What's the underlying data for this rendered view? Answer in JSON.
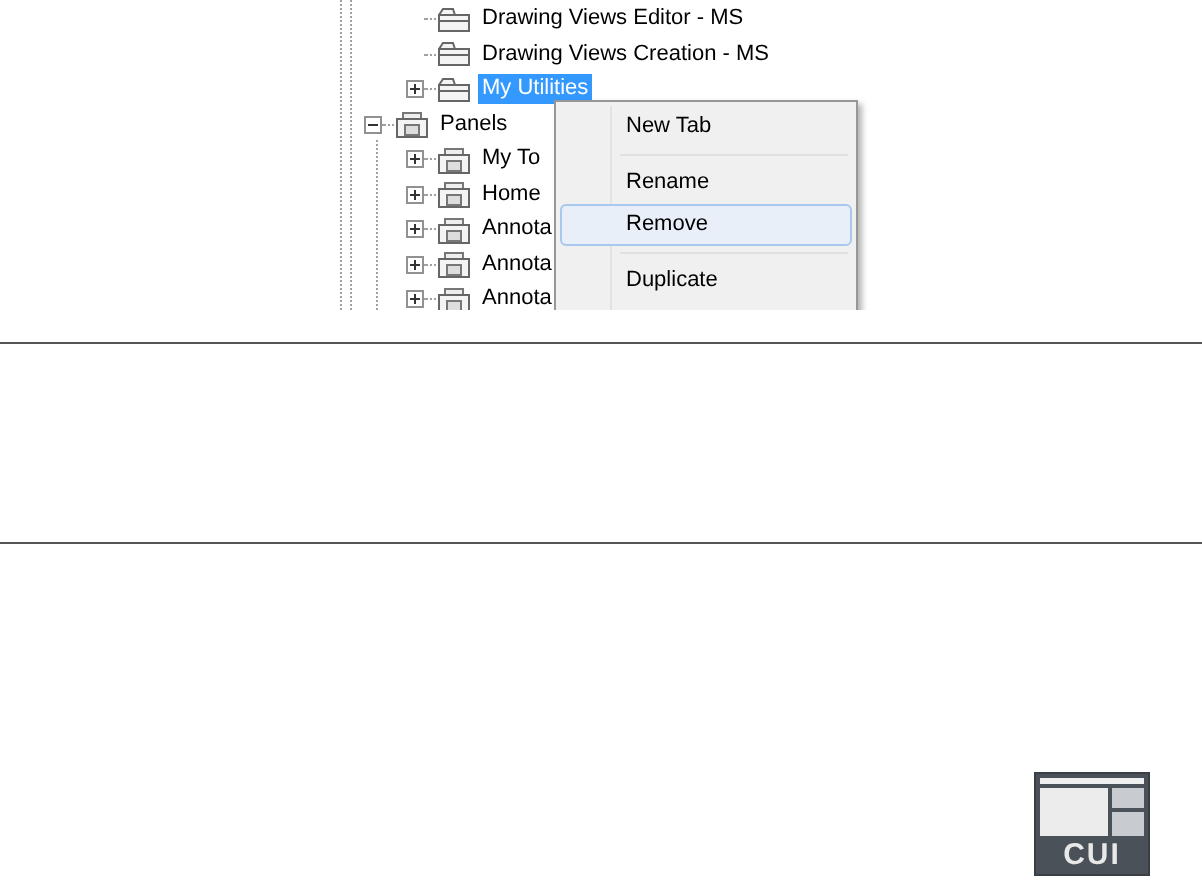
{
  "tree": {
    "items": [
      {
        "children": [
          {
            "label": "Drawing Views Editor - MS",
            "kind": "tab",
            "selected": false
          },
          {
            "label": "Drawing Views Creation - MS",
            "kind": "tab",
            "selected": false
          },
          {
            "label": "My Utilities",
            "kind": "tab",
            "selected": true,
            "expanded": false
          }
        ]
      },
      {
        "label": "Panels",
        "kind": "panel",
        "selected": false,
        "expanded": true,
        "children": [
          {
            "label": "My To",
            "kind": "panel",
            "selected": false,
            "expanded": false
          },
          {
            "label": "Home",
            "kind": "panel",
            "selected": false,
            "expanded": false
          },
          {
            "label": "Annota",
            "kind": "panel",
            "selected": false,
            "expanded": false
          },
          {
            "label": "Annota",
            "kind": "panel",
            "selected": false,
            "expanded": false
          },
          {
            "label": "Annota",
            "kind": "panel",
            "selected": false,
            "expanded": false
          }
        ]
      }
    ]
  },
  "context_menu": {
    "items": [
      {
        "kind": "item",
        "label": "New Tab",
        "selected": false
      },
      {
        "kind": "separator"
      },
      {
        "kind": "item",
        "label": "Rename",
        "selected": false
      },
      {
        "kind": "item",
        "label": "Remove",
        "selected": true
      },
      {
        "kind": "separator"
      },
      {
        "kind": "item",
        "label": "Duplicate",
        "selected": false
      }
    ]
  },
  "badge": {
    "label": "CUI"
  }
}
